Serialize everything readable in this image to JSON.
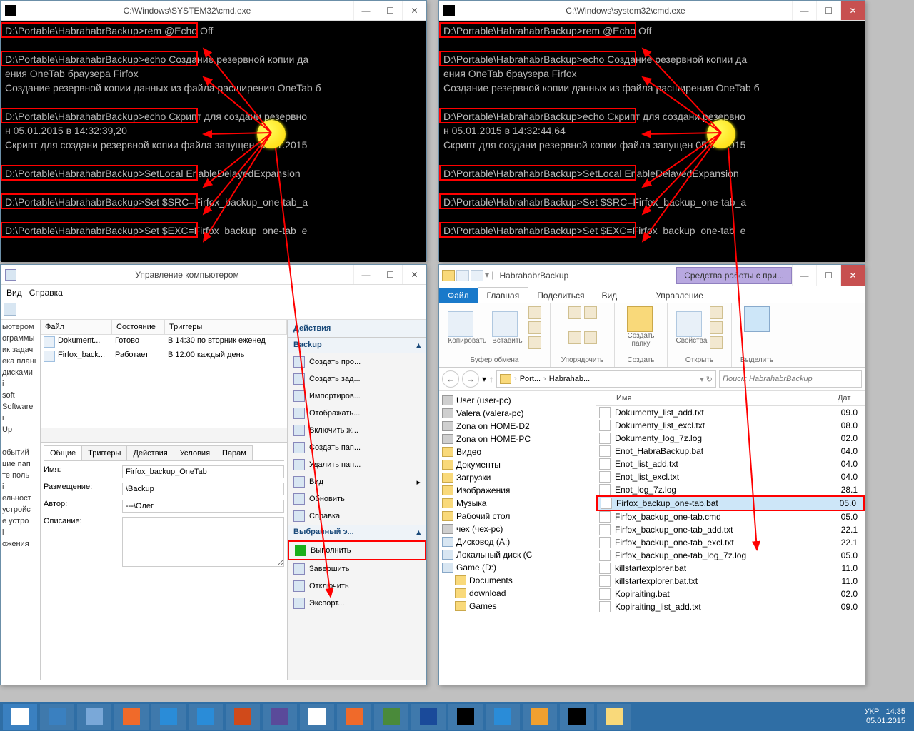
{
  "cmd_left": {
    "title": "C:\\Windows\\SYSTEM32\\cmd.exe",
    "lines": [
      "D:\\Portable\\HabrahabrBackup>rem @Echo Off",
      "",
      "D:\\Portable\\HabrahabrBackup>echo Создание резервной копии да",
      "ения OneTab браузера Firfox",
      "Создание резервной копии данных из файла расширения OneTab б",
      "",
      "D:\\Portable\\HabrahabrBackup>echo Скрипт для создани резервно",
      "н 05.01.2015 в 14:32:39,20",
      "Скрипт для создани резервной копии файла запущен 05.01.2015",
      "",
      "D:\\Portable\\HabrahabrBackup>SetLocal EnableDelayedExpansion",
      "",
      "D:\\Portable\\HabrahabrBackup>Set $SRC=Firfox_backup_one-tab_a",
      "",
      "D:\\Portable\\HabrahabrBackup>Set $EXC=Firfox_backup_one-tab_e"
    ]
  },
  "cmd_right": {
    "title": "C:\\Windows\\system32\\cmd.exe",
    "lines": [
      "D:\\Portable\\HabrahabrBackup>rem @Echo Off",
      "",
      "D:\\Portable\\HabrahabrBackup>echo Создание резервной копии да",
      "ения OneTab браузера Firfox",
      "Создание резервной копии данных из файла расширения OneTab б",
      "",
      "D:\\Portable\\HabrahabrBackup>echo Скрипт для создани резервно",
      "н 05.01.2015 в 14:32:44,64",
      "Скрипт для создани резервной копии файла запущен 05.01.2015",
      "",
      "D:\\Portable\\HabrahabrBackup>SetLocal EnableDelayedExpansion",
      "",
      "D:\\Portable\\HabrahabrBackup>Set $SRC=Firfox_backup_one-tab_a",
      "",
      "D:\\Portable\\HabrahabrBackup>Set $EXC=Firfox_backup_one-tab_e"
    ]
  },
  "mgmt": {
    "title": "Управление компьютером",
    "menu": {
      "view": "Вид",
      "help": "Справка"
    },
    "tree": [
      "ьютером",
      "ограммы",
      "ик задач",
      "ека плані",
      "дисками",
      "і",
      "soft",
      "Software",
      "і",
      "Up",
      "",
      "обытий",
      "цие пап",
      "те поль",
      "і",
      "ельност",
      "устройс",
      "е устро",
      "і",
      "ожения"
    ],
    "taskhdr": {
      "file": "Файл",
      "state": "Состояние",
      "trig": "Триггеры"
    },
    "tasks": [
      {
        "file": "Dokument...",
        "state": "Готово",
        "trig": "В 14:30 по вторник еженед"
      },
      {
        "file": "Firfox_back...",
        "state": "Работает",
        "trig": "В 12:00 каждый день"
      }
    ],
    "proptabs": [
      "Общие",
      "Триггеры",
      "Действия",
      "Условия",
      "Парам"
    ],
    "props": {
      "name_k": "Имя:",
      "name_v": "Firfox_backup_OneTab",
      "loc_k": "Размещение:",
      "loc_v": "\\Backup",
      "auth_k": "Автор:",
      "auth_v": "---\\Олег",
      "desc_k": "Описание:"
    },
    "actions": {
      "header": "Действия",
      "group1": "Backup",
      "items1": [
        "Создать про...",
        "Создать зад...",
        "Импортиров...",
        "Отображать...",
        "Включить ж...",
        "Создать пап...",
        "Удалить пап...",
        "Вид",
        "Обновить",
        "Справка"
      ],
      "group2": "Выбранный э...",
      "items2": [
        "Выполнить",
        "Завершить",
        "Отключить",
        "Экспорт..."
      ]
    }
  },
  "explorer": {
    "title": "HabrahabrBackup",
    "purple": "Средства работы с при...",
    "ribtabs": {
      "file": "Файл",
      "home": "Главная",
      "share": "Поделиться",
      "view": "Вид",
      "manage": "Управление"
    },
    "ribgrp": {
      "clip": {
        "copy": "Копировать",
        "paste": "Вставить",
        "label": "Буфер обмена"
      },
      "org": {
        "label": "Упорядочить"
      },
      "new": {
        "newfolder": "Создать\nпапку",
        "label": "Создать"
      },
      "open": {
        "props": "Свойства",
        "label": "Открыть"
      },
      "sel": {
        "select": "Выделить"
      }
    },
    "crumbs": [
      "Port...",
      "Habrahab..."
    ],
    "search_ph": "Поиск: HabrahabrBackup",
    "nav": [
      "User (user-pc)",
      "Valera (valera-pc)",
      "Zona on HOME-D2",
      "Zona on HOME-PC",
      "Видео",
      "Документы",
      "Загрузки",
      "Изображения",
      "Музыка",
      "Рабочий стол",
      "чех (чех-рс)",
      "Дисковод (A:)",
      "Локальный диск (C",
      "Game (D:)",
      "Documents",
      "download",
      "Games"
    ],
    "col_name": "Имя",
    "col_date": "Дат",
    "files": [
      {
        "n": "Dokumenty_list_add.txt",
        "d": "09.0"
      },
      {
        "n": "Dokumenty_list_excl.txt",
        "d": "08.0"
      },
      {
        "n": "Dokumenty_log_7z.log",
        "d": "02.0"
      },
      {
        "n": "Enot_HabraBackup.bat",
        "d": "04.0"
      },
      {
        "n": "Enot_list_add.txt",
        "d": "04.0"
      },
      {
        "n": "Enot_list_excl.txt",
        "d": "04.0"
      },
      {
        "n": "Enot_log_7z.log",
        "d": "28.1"
      },
      {
        "n": "Firfox_backup_one-tab.bat",
        "d": "05.0",
        "sel": true
      },
      {
        "n": "Firfox_backup_one-tab.cmd",
        "d": "05.0"
      },
      {
        "n": "Firfox_backup_one-tab_add.txt",
        "d": "22.1"
      },
      {
        "n": "Firfox_backup_one-tab_excl.txt",
        "d": "22.1"
      },
      {
        "n": "Firfox_backup_one-tab_log_7z.log",
        "d": "05.0"
      },
      {
        "n": "killstartexplorer.bat",
        "d": "11.0"
      },
      {
        "n": "killstartexplorer.bat.txt",
        "d": "11.0"
      },
      {
        "n": "Kopiraiting.bat",
        "d": "02.0"
      },
      {
        "n": "Kopiraiting_list_add.txt",
        "d": "09.0"
      }
    ]
  },
  "taskbar": {
    "lang": "УКР",
    "time": "14:35",
    "date": "05.01.2015"
  },
  "winctrl": {
    "min": "—",
    "max": "☐",
    "close": "✕"
  }
}
